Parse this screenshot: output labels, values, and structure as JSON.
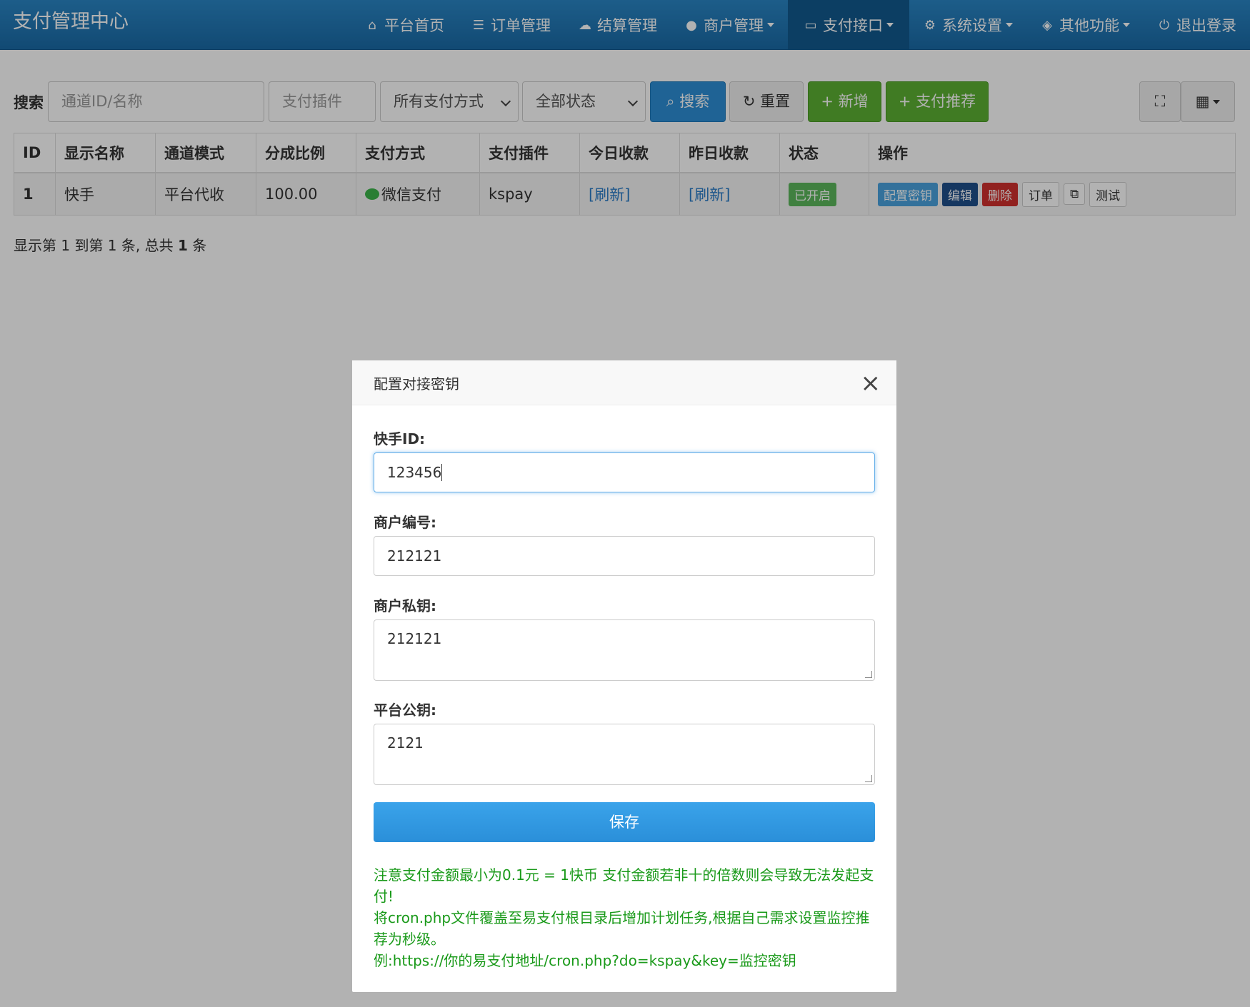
{
  "navbar": {
    "brand": "支付管理中心",
    "items": [
      {
        "label": "平台首页",
        "icon": "home-icon"
      },
      {
        "label": "订单管理",
        "icon": "list-icon"
      },
      {
        "label": "结算管理",
        "icon": "cloud-icon"
      },
      {
        "label": "商户管理",
        "icon": "user-icon"
      },
      {
        "label": "支付接口",
        "icon": "credit-card-icon"
      },
      {
        "label": "系统设置",
        "icon": "gear-icon"
      },
      {
        "label": "其他功能",
        "icon": "cube-icon"
      },
      {
        "label": "退出登录",
        "icon": "power-icon"
      }
    ]
  },
  "toolbar": {
    "search_label": "搜索",
    "id_placeholder": "通道ID/名称",
    "plugin_placeholder": "支付插件",
    "pay_type": "所有支付方式",
    "status": "全部状态",
    "search_btn": "搜索",
    "reset_btn": "重置",
    "add_btn": "新增",
    "recommend_btn": "支付推荐"
  },
  "table": {
    "headers": [
      "ID",
      "显示名称",
      "通道模式",
      "分成比例",
      "支付方式",
      "支付插件",
      "今日收款",
      "昨日收款",
      "状态",
      "操作"
    ],
    "rows": [
      {
        "id": "1",
        "name": "快手",
        "mode": "平台代收",
        "rate": "100.00",
        "pay_type": "微信支付",
        "plugin": "kspay",
        "today": "[刷新]",
        "yesterday": "[刷新]",
        "status": "已开启",
        "ops": {
          "config": "配置密钥",
          "edit": "编辑",
          "delete": "删除",
          "orders": "订单",
          "test": "测试"
        }
      }
    ]
  },
  "pager": {
    "prefix": "显示第 1 到第 1 条, 总共 ",
    "total": "1",
    "suffix": " 条"
  },
  "modal": {
    "title": "配置对接密钥",
    "fields": [
      {
        "label": "快手ID:",
        "value": "123456"
      },
      {
        "label": "商户编号:",
        "value": "212121"
      },
      {
        "label": "商户私钥:",
        "value": "212121"
      },
      {
        "label": "平台公钥:",
        "value": "2121"
      }
    ],
    "save": "保存",
    "notes": [
      "注意支付金额最小为0.1元 = 1快币 支付金额若非十的倍数则会导致无法发起支付!",
      "将cron.php文件覆盖至易支付根目录后增加计划任务,根据自己需求设置监控推荐为秒级。",
      "例:https://你的易支付地址/cron.php?do=kspay&key=监控密钥"
    ]
  },
  "colors": {
    "nav": "#1a6aa6",
    "primary": "#2d8fd6",
    "success": "#5cb133",
    "note": "#1a9a1a"
  }
}
